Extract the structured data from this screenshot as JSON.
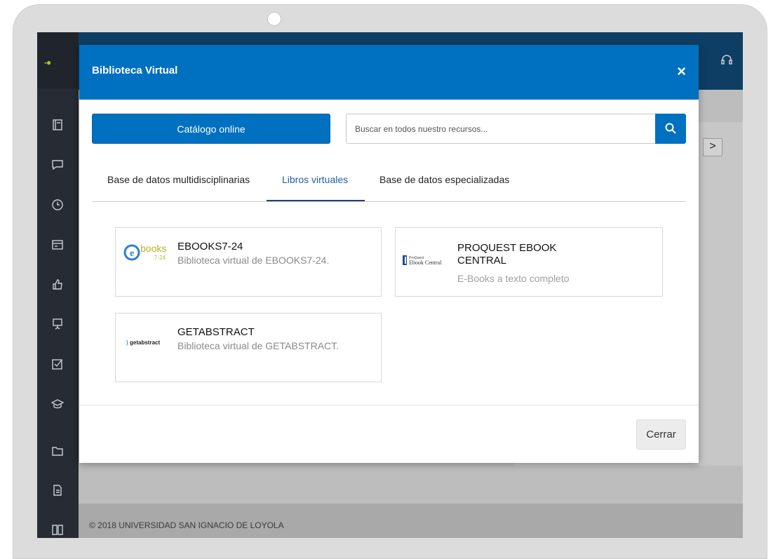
{
  "modal": {
    "title": "Biblioteca Virtual",
    "close_icon_glyph": "×",
    "catalog_button": "Catálogo online",
    "search": {
      "placeholder": "Buscar en todos nuestro recursos...",
      "value": ""
    },
    "tabs": [
      {
        "label": "Base de datos multidisciplinarias",
        "active": false
      },
      {
        "label": "Libros virtuales",
        "active": true
      },
      {
        "label": "Base de datos especializadas",
        "active": false
      }
    ],
    "resources": [
      {
        "title": "EBOOKS7-24",
        "description": "Biblioteca virtual de EBOOKS7-24.",
        "logo": {
          "main": "books",
          "sub": "7-24"
        }
      },
      {
        "title": "PROQUEST EBOOK CENTRAL",
        "description": "E-Books a texto completo",
        "logo": {
          "small": "ProQuest",
          "main": "Ebook Central"
        }
      },
      {
        "title": "GETABSTRACT",
        "description": "Biblioteca virtual de GETABSTRACT.",
        "logo": {
          "main": "getabstract"
        }
      }
    ],
    "footer_close_button": "Cerrar"
  },
  "background": {
    "footer_text": "© 2018 UNIVERSIDAD SAN IGNACIO DE LOYOLA",
    "nav_arrow_glyph": ">",
    "logo_mark": "-●"
  },
  "colors": {
    "primary": "#0070c0",
    "header_dark": "#0e3e63",
    "sidebar": "#262b34",
    "accent_green": "#9acd32"
  },
  "icons": [
    "close-icon",
    "search-icon",
    "chevron-right-icon",
    "headset-icon",
    "book-icon",
    "chat-icon",
    "clock-icon",
    "card-icon",
    "thumb-icon",
    "presentation-icon",
    "checkbox-icon",
    "graduation-cap-icon",
    "folder-icon",
    "document-icon",
    "open-book-icon"
  ]
}
